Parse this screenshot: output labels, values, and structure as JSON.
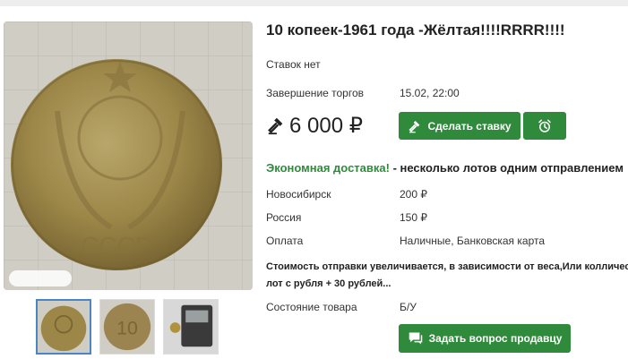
{
  "lot": {
    "title": "10 копеек-1961 года -Жёлтая!!!!RRRR!!!!",
    "bids_status": "Ставок нет",
    "end_label": "Завершение торгов",
    "end_value": "15.02, 22:00",
    "price": "6 000 ₽"
  },
  "actions": {
    "bid_label": "Сделать ставку",
    "ask_label": "Задать вопрос продавцу"
  },
  "delivery": {
    "highlight": "Экономная доставка!",
    "rest": " - несколько лотов одним отправлением",
    "rows": [
      {
        "label": "Новосибирск",
        "value": "200 ₽"
      },
      {
        "label": "Россия",
        "value": "150 ₽"
      },
      {
        "label": "Оплата",
        "value": "Наличные, Банковская карта"
      }
    ],
    "note_line1": "Стоимость отправки увеличивается, в зависимости от веса,Или колличест",
    "note_line2": "лот с рубля + 30 рублей..."
  },
  "condition": {
    "label": "Состояние товара",
    "value": "Б/У"
  },
  "colors": {
    "accent_green": "#2f8a3b",
    "thumb_active_border": "#4a86c5"
  },
  "icons": {
    "price": "auction-hammer-icon",
    "bid": "auction-hammer-icon",
    "alarm": "alarm-clock-icon",
    "ask": "chat-bubble-icon"
  },
  "gallery": {
    "thumbnail_count": 3,
    "active_index": 0
  }
}
